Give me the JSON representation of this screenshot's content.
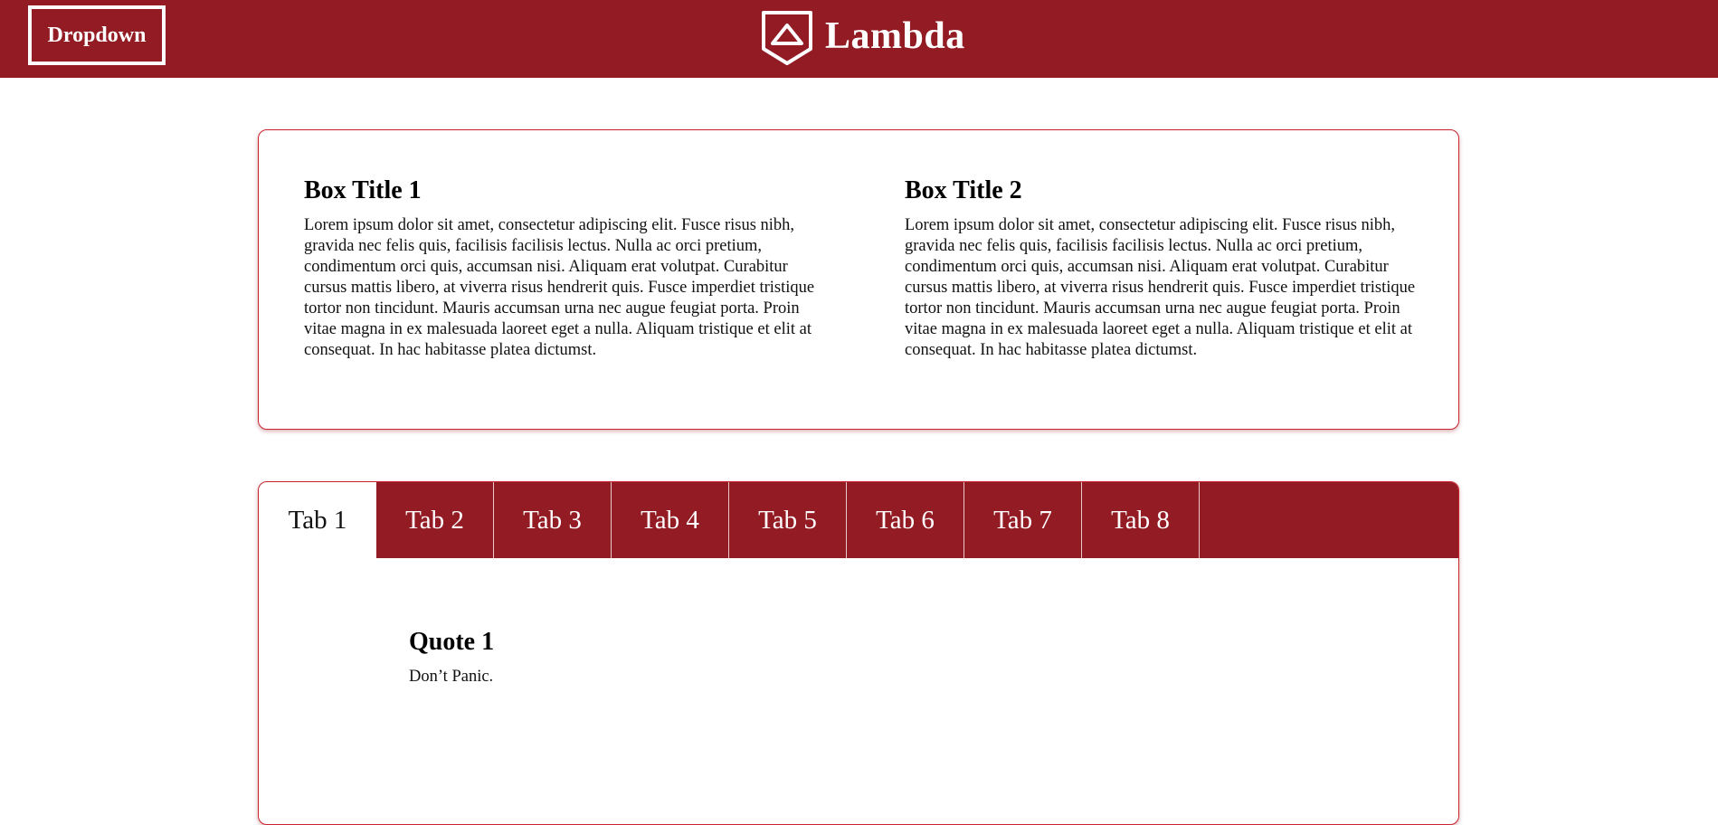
{
  "header": {
    "dropdown_label": "Dropdown",
    "logo_text": "Lambda",
    "logo_icon": "shield-icon",
    "background_color": "#931c24"
  },
  "boxes": [
    {
      "title": "Box Title 1",
      "text": "Lorem ipsum dolor sit amet, consectetur adipiscing elit. Fusce risus nibh, gravida nec felis quis, facilisis facilisis lectus. Nulla ac orci pretium, condimentum orci quis, accumsan nisi. Aliquam erat volutpat. Curabitur cursus mattis libero, at viverra risus hendrerit quis. Fusce imperdiet tristique tortor non tincidunt. Mauris accumsan urna nec augue feugiat porta. Proin vitae magna in ex malesuada laoreet eget a nulla. Aliquam tristique et elit at consequat. In hac habitasse platea dictumst."
    },
    {
      "title": "Box Title 2",
      "text": "Lorem ipsum dolor sit amet, consectetur adipiscing elit. Fusce risus nibh, gravida nec felis quis, facilisis facilisis lectus. Nulla ac orci pretium, condimentum orci quis, accumsan nisi. Aliquam erat volutpat. Curabitur cursus mattis libero, at viverra risus hendrerit quis. Fusce imperdiet tristique tortor non tincidunt. Mauris accumsan urna nec augue feugiat porta. Proin vitae magna in ex malesuada laoreet eget a nulla. Aliquam tristique et elit at consequat. In hac habitasse platea dictumst."
    }
  ],
  "tabs": {
    "items": [
      "Tab 1",
      "Tab 2",
      "Tab 3",
      "Tab 4",
      "Tab 5",
      "Tab 6",
      "Tab 7",
      "Tab 8"
    ],
    "active_index": 0,
    "content": {
      "title": "Quote 1",
      "text": "Don’t Panic."
    }
  },
  "colors": {
    "accent": "#931c24",
    "border": "#c8232f"
  }
}
